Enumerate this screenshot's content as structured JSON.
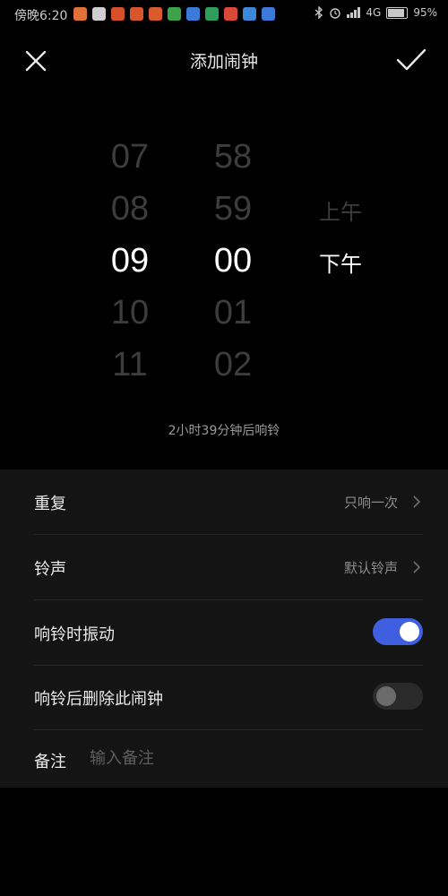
{
  "status_bar": {
    "time": "傍晚6:20",
    "network": "4G",
    "battery": "95%",
    "app_icon_colors": [
      "#e0703a",
      "#cfcfcf",
      "#d94f2a",
      "#d9562c",
      "#d95a2c",
      "#3ca34a",
      "#3b7ad9",
      "#2f9e5c",
      "#d94a3a",
      "#3b88d9",
      "#3b7ad9"
    ]
  },
  "header": {
    "title": "添加闹钟"
  },
  "picker": {
    "hours": [
      "07",
      "08",
      "09",
      "10",
      "11"
    ],
    "minutes": [
      "58",
      "59",
      "00",
      "01",
      "02"
    ],
    "ampm": [
      "上午",
      "下午"
    ],
    "selected_hour": "09",
    "selected_minute": "00",
    "selected_ampm": "下午"
  },
  "ring_hint": "2小时39分钟后响铃",
  "settings": {
    "repeat": {
      "label": "重复",
      "value": "只响一次"
    },
    "ringtone": {
      "label": "铃声",
      "value": "默认铃声"
    },
    "vibrate": {
      "label": "响铃时振动",
      "on": true
    },
    "delete_after": {
      "label": "响铃后删除此闹钟",
      "on": false
    },
    "note": {
      "label": "备注",
      "placeholder": "输入备注"
    }
  },
  "colors": {
    "accent": "#3f5fe0",
    "background": "#000000",
    "panel": "#141414"
  }
}
